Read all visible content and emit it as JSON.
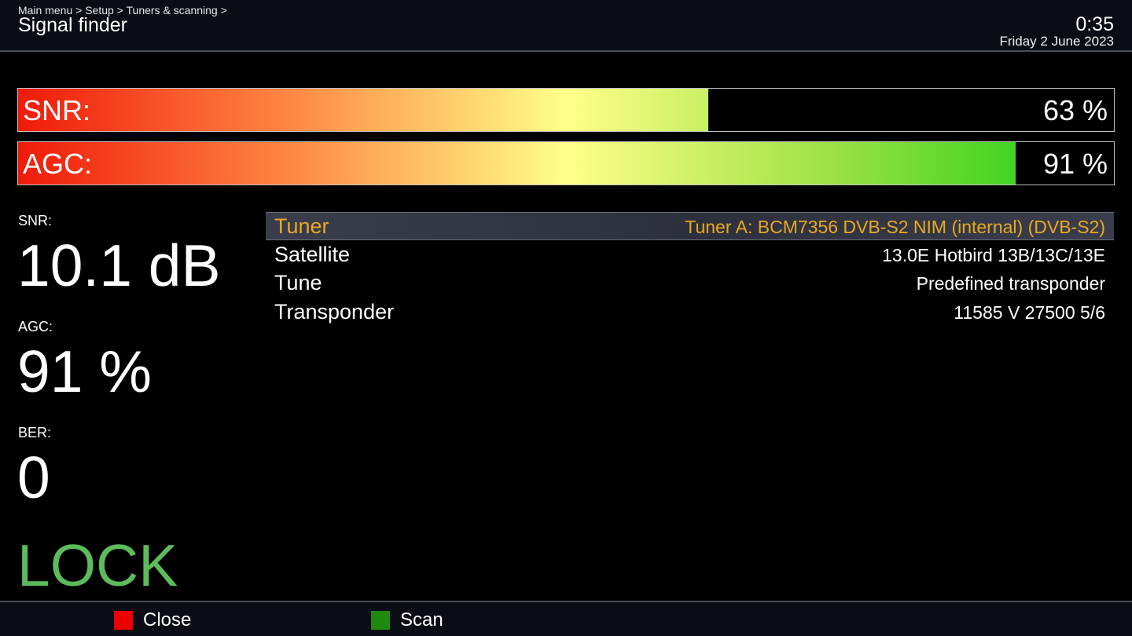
{
  "header": {
    "breadcrumb": "Main menu > Setup > Tuners & scanning >",
    "title": "Signal finder",
    "time": "0:35",
    "date": "Friday  2 June 2023"
  },
  "bars": [
    {
      "label": "SNR:",
      "value_text": "63 %",
      "level": 0.63
    },
    {
      "label": "AGC:",
      "value_text": "91 %",
      "level": 0.91
    }
  ],
  "stats": {
    "snr_label": "SNR:",
    "snr_value": "10.1 dB",
    "agc_label": "AGC:",
    "agc_value": "91 %",
    "ber_label": "BER:",
    "ber_value": "0",
    "lock": "LOCK"
  },
  "config": [
    {
      "key": "Tuner",
      "value": "Tuner A: BCM7356 DVB-S2 NIM (internal) (DVB-S2)",
      "selected": true
    },
    {
      "key": "Satellite",
      "value": "13.0E Hotbird 13B/13C/13E",
      "selected": false
    },
    {
      "key": "Tune",
      "value": "Predefined transponder",
      "selected": false
    },
    {
      "key": "Transponder",
      "value": "11585 V 27500 5/6",
      "selected": false
    }
  ],
  "footer": {
    "red_label": "Close",
    "red_color": "#ee0000",
    "green_label": "Scan",
    "green_color": "#1f8a10"
  }
}
